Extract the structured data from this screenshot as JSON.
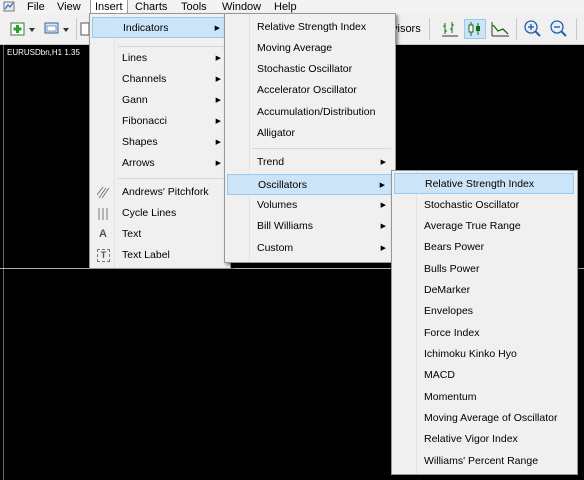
{
  "menubar": {
    "items": [
      {
        "label": "File"
      },
      {
        "label": "View"
      },
      {
        "label": "Insert"
      },
      {
        "label": "Charts"
      },
      {
        "label": "Tools"
      },
      {
        "label": "Window"
      },
      {
        "label": "Help"
      }
    ]
  },
  "toolbar": {
    "advisors_label": "visors"
  },
  "chart": {
    "title": "EURUSDbn,H1 1.35"
  },
  "insert_menu": {
    "items": [
      {
        "label": "Indicators"
      },
      {
        "label": "Lines"
      },
      {
        "label": "Channels"
      },
      {
        "label": "Gann"
      },
      {
        "label": "Fibonacci"
      },
      {
        "label": "Shapes"
      },
      {
        "label": "Arrows"
      },
      {
        "label": "Andrews' Pitchfork"
      },
      {
        "label": "Cycle Lines"
      },
      {
        "label": "Text"
      },
      {
        "label": "Text Label"
      }
    ],
    "icons": {
      "text_icon": "A",
      "text_label_icon": "T"
    }
  },
  "indicators_menu": {
    "items": [
      {
        "label": "Relative Strength Index"
      },
      {
        "label": "Moving Average"
      },
      {
        "label": "Stochastic Oscillator"
      },
      {
        "label": "Accelerator Oscillator"
      },
      {
        "label": "Accumulation/Distribution"
      },
      {
        "label": "Alligator"
      },
      {
        "label": "Trend"
      },
      {
        "label": "Oscillators"
      },
      {
        "label": "Volumes"
      },
      {
        "label": "Bill Williams"
      },
      {
        "label": "Custom"
      }
    ]
  },
  "oscillators_menu": {
    "items": [
      {
        "label": "Relative Strength Index"
      },
      {
        "label": "Stochastic Oscillator"
      },
      {
        "label": "Average True Range"
      },
      {
        "label": "Bears Power"
      },
      {
        "label": "Bulls Power"
      },
      {
        "label": "DeMarker"
      },
      {
        "label": "Envelopes"
      },
      {
        "label": "Force Index"
      },
      {
        "label": "Ichimoku Kinko Hyo"
      },
      {
        "label": "MACD"
      },
      {
        "label": "Momentum"
      },
      {
        "label": "Moving Average of Oscillator"
      },
      {
        "label": "Relative Vigor Index"
      },
      {
        "label": "Williams' Percent Range"
      }
    ]
  },
  "colors": {
    "highlight": "#cce4f7",
    "highlight_border": "#99c9ef",
    "menu_bg": "#f0f0f0",
    "chart_bg": "#000000"
  },
  "icon_names": [
    "new-chart-icon",
    "profiles-icon",
    "toolbar-chart-icon",
    "bar-chart-icon",
    "candlestick-icon",
    "line-chart-icon",
    "zoom-in-icon",
    "zoom-out-icon",
    "pitchfork-icon",
    "cycle-lines-icon",
    "text-icon",
    "text-label-icon"
  ]
}
